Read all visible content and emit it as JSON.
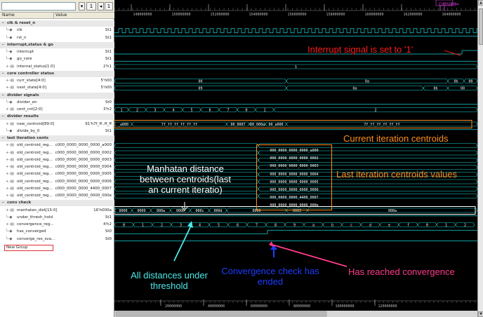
{
  "toolbar": {
    "zoom_value": "1",
    "page_value": "1"
  },
  "columns": {
    "name": "Name",
    "value": "Value"
  },
  "rows": [
    {
      "label": "clk & reset_n",
      "group": true
    },
    {
      "label": "clk",
      "value": "St1",
      "depth": 2,
      "icon": "leaf"
    },
    {
      "label": "rst_n",
      "value": "St1",
      "depth": 2,
      "icon": "leaf"
    },
    {
      "label": "interrupt,status & go",
      "group": true
    },
    {
      "label": "interrupt",
      "value": "St1",
      "depth": 2,
      "icon": "leaf"
    },
    {
      "label": "go_core",
      "value": "St1",
      "depth": 2,
      "icon": "leaf"
    },
    {
      "label": "internal_status[1:0]",
      "value": "2'h1",
      "depth": 2,
      "icon": "bus"
    },
    {
      "label": "core controller status",
      "group": true
    },
    {
      "label": "curr_state[4:0]",
      "value": "5'h00",
      "depth": 2,
      "icon": "bus"
    },
    {
      "label": "next_state[4:0]",
      "value": "5'h00",
      "depth": 2,
      "icon": "bus"
    },
    {
      "label": "divider signals",
      "group": true
    },
    {
      "label": "divider_en",
      "value": "St0",
      "depth": 2,
      "icon": "leaf"
    },
    {
      "label": "cent_cnt[2:0]",
      "value": "3'h2",
      "depth": 2,
      "icon": "bus"
    },
    {
      "label": "divider results",
      "group": true
    },
    {
      "label": "new_centroid[89:0]",
      "value": "91'h7f_ff..ff_ff",
      "depth": 2,
      "icon": "bus"
    },
    {
      "label": "divide_by_0",
      "value": "St1",
      "depth": 2,
      "icon": "leaf"
    },
    {
      "label": "last iteration cents",
      "group": true
    },
    {
      "label": "old_centroid_reg...",
      "value": "c000_0000_0000_0000_a000",
      "depth": 2,
      "icon": "bus"
    },
    {
      "label": "old_centroid_reg...",
      "value": "c000_0000_0000_0000_0002",
      "depth": 2,
      "icon": "bus"
    },
    {
      "label": "old_centroid_reg...",
      "value": "c000_0000_0000_0000_0003",
      "depth": 2,
      "icon": "bus"
    },
    {
      "label": "old_centroid_reg...",
      "value": "c000_0000_0000_0000_0004",
      "depth": 2,
      "icon": "bus"
    },
    {
      "label": "old_centroid_reg...",
      "value": "c000_0000_0000_0000_0005",
      "depth": 2,
      "icon": "bus"
    },
    {
      "label": "old_centroid_reg...",
      "value": "c000_0000_0000_0000_0006",
      "depth": 2,
      "icon": "bus"
    },
    {
      "label": "old_centroid_reg...",
      "value": "c000_0000_0000_4400_0007",
      "depth": 2,
      "icon": "bus"
    },
    {
      "label": "old_centroid_reg...",
      "value": "c000_0000_0000_0000_000e",
      "depth": 2,
      "icon": "bus"
    },
    {
      "label": "conv check",
      "group": true
    },
    {
      "label": "manhatan_dist[15:0]",
      "value": "16'h000a",
      "depth": 2,
      "icon": "bus"
    },
    {
      "label": "under_thresh_hold",
      "value": "St1",
      "depth": 2,
      "icon": "leaf"
    },
    {
      "label": "convergence_reg...",
      "value": "4'h2",
      "depth": 2,
      "icon": "bus"
    },
    {
      "label": "has_converged",
      "value": "St0",
      "depth": 2,
      "icon": "leaf"
    },
    {
      "label": "converge_res_sva...",
      "value": "St0",
      "depth": 2,
      "icon": "leaf"
    }
  ],
  "new_group_label": "New Group",
  "timeline": {
    "cursor_label": "CURSOR0=",
    "top_ticks": [
      "148000000",
      "150000000",
      "152000000",
      "154000000",
      "156000000",
      "158000000",
      "160000000",
      "162000000",
      "164000000"
    ],
    "bottom_ticks": [
      "20000000",
      "40000000",
      "60000000",
      "80000000",
      "100000000",
      "120000000"
    ]
  },
  "waveforms": {
    "internal_status": "1",
    "curr_state": [
      "00",
      "0a",
      "0b",
      "00"
    ],
    "next_state": [
      "09",
      "0a",
      "0b",
      "00"
    ],
    "cent_cnt": [
      "1",
      "2",
      "3",
      "4",
      "5",
      "6",
      "7",
      "0",
      "1",
      "2"
    ],
    "new_centroid": [
      "_a000",
      "7f_ff_ff_ff_ff_ff",
      "00_0007",
      "00_000a",
      "00_a000",
      "7f_ff_ff_ff_ff_ff"
    ],
    "old_centroid_values": [
      "000_0000_0000_0000_a000",
      "000_0000_0000_0000_0002",
      "000_0000_0000_0000_0003",
      "000_0000_0000_0000_0004",
      "000_0000_0000_0000_0005",
      "000_0000_0000_0000_0006",
      "000_0000_0000_4400_0007",
      "000_0000_0000_0000_000e"
    ],
    "manhatan": [
      "0000",
      "0009",
      "000a",
      "000b",
      "000c",
      "000d",
      "0000",
      "0003",
      "000a"
    ],
    "convergence": [
      "0",
      "1",
      "2",
      "3",
      "4",
      "5",
      "6",
      "7",
      "8",
      "9",
      "a",
      "b",
      "c",
      "d",
      "e",
      "f",
      "0",
      "1",
      "2"
    ]
  },
  "annotations": {
    "interrupt": "Interrupt signal is set to '1'",
    "current_centroids": "Current iteration centroids",
    "last_centroids": "Last iteration centroids values",
    "manhatan_line1": "Manhatan distance",
    "manhatan_line2": "between centroids(last",
    "manhatan_line3": "an current iteratio)",
    "threshold_line1": "All distances under",
    "threshold_line2": "threshold",
    "conv_check_line1": "Convergence check has",
    "conv_check_line2": "ended",
    "has_reached": "Has reached convergence"
  },
  "colors": {
    "wave": "#19d7d7",
    "red": "#ff1a1a",
    "orange": "#ff8c1a",
    "pink": "#ff3b8a",
    "blue": "#1f3cff",
    "cyan": "#4de8e8"
  }
}
